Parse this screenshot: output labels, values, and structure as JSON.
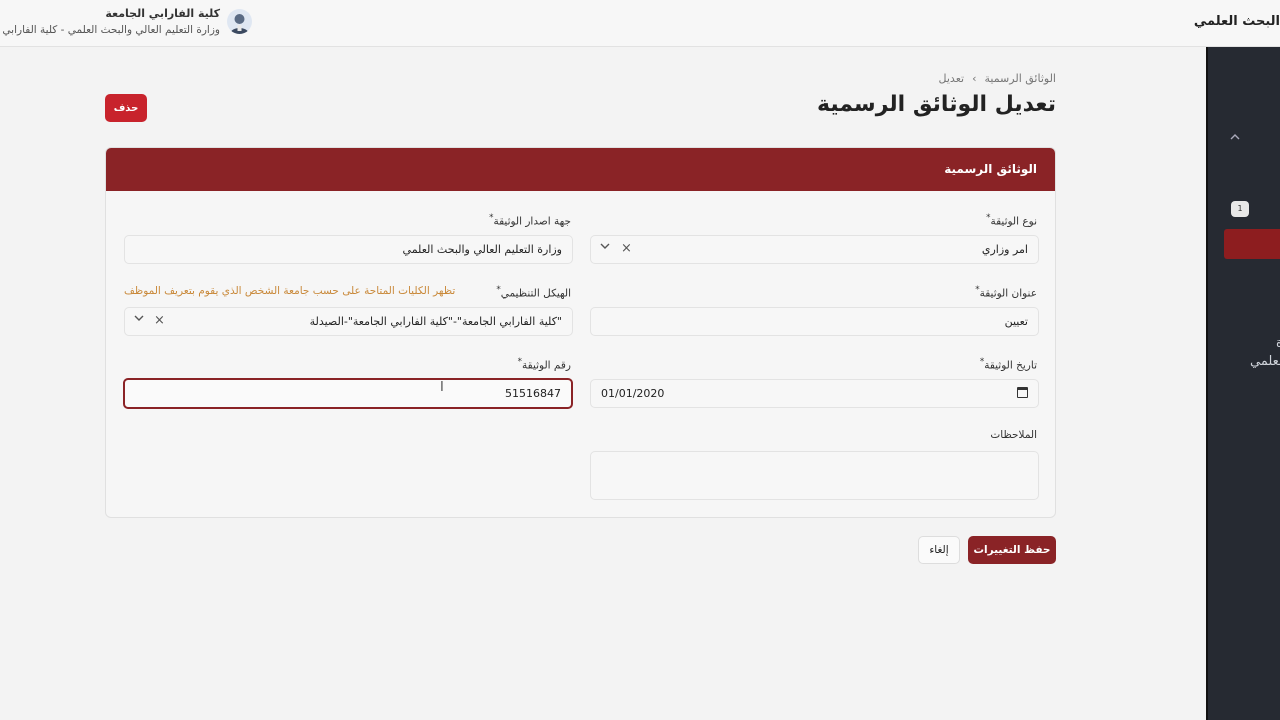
{
  "topbar": {
    "brand_partial": "البحث العلمي",
    "user_name": "كلية الفارابي الجامعة",
    "user_org": "وزارة التعليم العالي والبحث العلمي - كلية الفارابي الجامعة"
  },
  "sidebar": {
    "badge": "1",
    "text_line1": "ة",
    "text_line2": "لعلمي"
  },
  "breadcrumb": {
    "parent": "الوثائق الرسمية",
    "separator": "›",
    "current": "تعديل"
  },
  "page": {
    "title": "تعديل الوثائق الرسمية",
    "delete_label": "حذف"
  },
  "card": {
    "header": "الوثائق الرسمية"
  },
  "form": {
    "doc_type": {
      "label": "نوع الوثيقة",
      "value": "امر وزاري"
    },
    "issuer": {
      "label": "جهة اصدار الوثيقة",
      "value": "وزارة التعليم العالي والبحث العلمي"
    },
    "doc_title": {
      "label": "عنوان الوثيقة",
      "value": "تعيين"
    },
    "org_structure": {
      "label": "الهيكل التنظيمي",
      "hint": "تظهر الكليات المتاحة على حسب جامعة الشخص الذي يقوم بتعريف الموظف",
      "value": "\"كلية الفارابي الجامعة\"-\"كلية الفارابي الجامعة\"-الصيدلة"
    },
    "doc_date": {
      "label": "تاريخ الوثيقة",
      "value": "01/01/2020"
    },
    "doc_number": {
      "label": "رقم الوثيقة",
      "value": "51516847"
    },
    "notes": {
      "label": "الملاحظات",
      "value": ""
    },
    "required_mark": "*"
  },
  "actions": {
    "save_label": "حفظ التغييرات",
    "cancel_label": "إلغاء"
  },
  "colors": {
    "primary": "#8a2326",
    "danger": "#c8232c",
    "sidebar": "#262a32",
    "hint": "#c9893a"
  }
}
